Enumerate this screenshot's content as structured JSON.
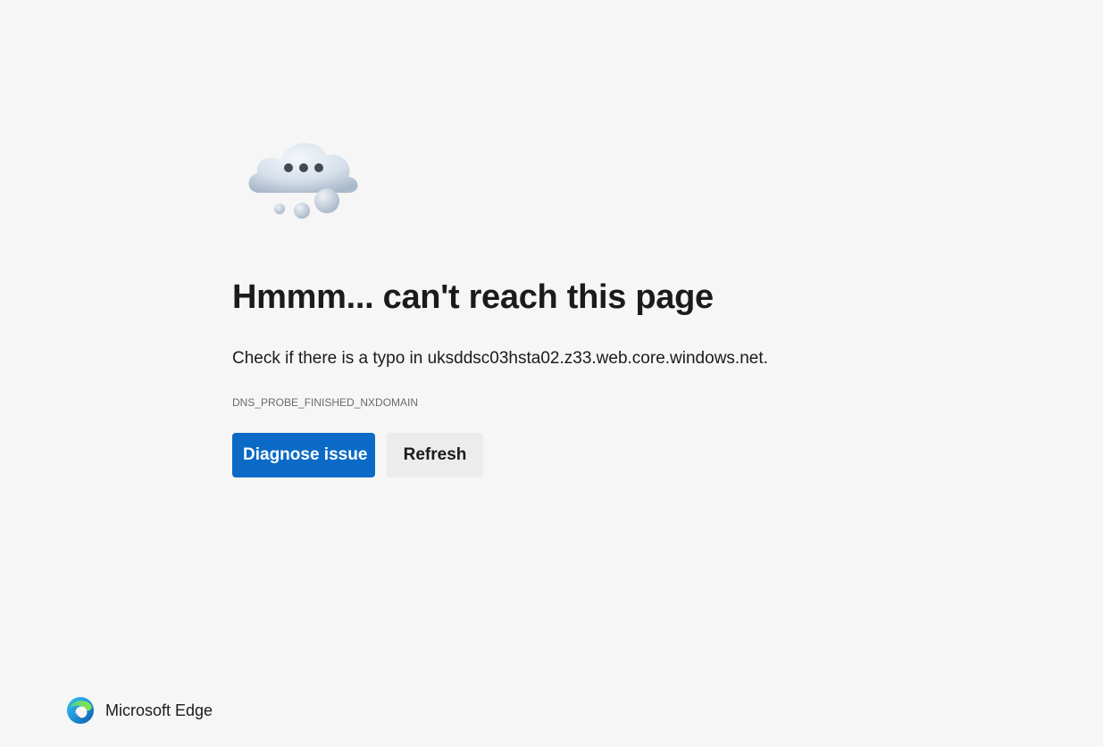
{
  "error_page": {
    "illustration": "cloud-thinking-icon",
    "title": "Hmmm... can't reach this page",
    "message": "Check if there is a typo in uksddsc03hsta02.z33.web.core.windows.net.",
    "error_code": "DNS_PROBE_FINISHED_NXDOMAIN",
    "buttons": {
      "diagnose_label": "Diagnose issue",
      "refresh_label": "Refresh"
    }
  },
  "footer": {
    "logo": "edge-logo-icon",
    "brand_name": "Microsoft Edge"
  },
  "colors": {
    "background": "#f6f6f6",
    "primary_button": "#0a6ac6",
    "secondary_button": "#ececec",
    "text": "#1b1b1b",
    "muted_text": "#6b6b6b"
  }
}
